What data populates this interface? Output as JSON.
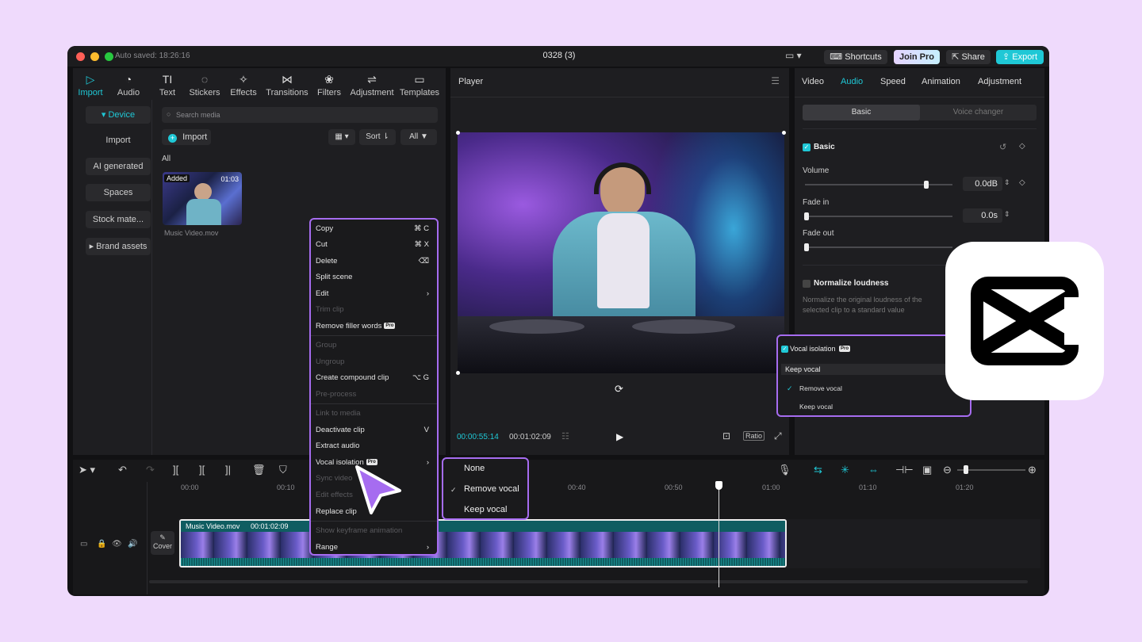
{
  "titlebar": {
    "autosave": "Auto saved: 18:26:16",
    "project": "0328 (3)",
    "shortcuts": "Shortcuts",
    "join_pro": "Join Pro",
    "share": "Share",
    "export": "Export"
  },
  "toolbar": [
    {
      "icon": "▷",
      "label": "Import"
    },
    {
      "icon": "◔",
      "label": "Audio"
    },
    {
      "icon": "TI",
      "label": "Text"
    },
    {
      "icon": "◌",
      "label": "Stickers"
    },
    {
      "icon": "✧",
      "label": "Effects"
    },
    {
      "icon": "⋈",
      "label": "Transitions"
    },
    {
      "icon": "❀",
      "label": "Filters"
    },
    {
      "icon": "⇌",
      "label": "Adjustment"
    },
    {
      "icon": "▭",
      "label": "Templates"
    }
  ],
  "sidebar": {
    "device": "▾ Device",
    "import": "Import",
    "ai": "AI generated",
    "spaces": "Spaces",
    "stock": "Stock mate...",
    "brand": "▸ Brand assets"
  },
  "media": {
    "search_placeholder": "Search media",
    "import_btn": "Import",
    "sort": "Sort",
    "all_btn": "All",
    "section": "All",
    "thumb_badge": "Added",
    "thumb_duration": "01:03",
    "thumb_name": "Music Video.mov"
  },
  "context_menu": {
    "copy": "Copy",
    "copy_sc": "⌘ C",
    "cut": "Cut",
    "cut_sc": "⌘ X",
    "delete": "Delete",
    "delete_sc": "⌫",
    "split": "Split scene",
    "edit": "Edit",
    "trim": "Trim clip",
    "filler": "Remove filler words",
    "pro_tag": "Pro",
    "group": "Group",
    "ungroup": "Ungroup",
    "compound": "Create compound clip",
    "compound_sc": "⌥ G",
    "preprocess": "Pre-process",
    "link": "Link to media",
    "deactivate": "Deactivate clip",
    "deactivate_sc": "V",
    "extract": "Extract audio",
    "vocal": "Vocal isolation",
    "sync": "Sync video",
    "edit_effects": "Edit effects",
    "replace": "Replace clip",
    "keyframe": "Show keyframe animation",
    "range": "Range"
  },
  "submenu": {
    "none": "None",
    "remove": "Remove vocal",
    "keep": "Keep vocal",
    "check": "✓"
  },
  "player": {
    "title": "Player",
    "current": "00:00:55:14",
    "total": "00:01:02:09",
    "ratio": "Ratio"
  },
  "inspector": {
    "tabs": [
      "Video",
      "Audio",
      "Speed",
      "Animation",
      "Adjustment"
    ],
    "seg_basic": "Basic",
    "seg_voice": "Voice changer",
    "section_basic": "Basic",
    "volume_label": "Volume",
    "volume_value": "0.0dB",
    "fadein_label": "Fade in",
    "fadein_value": "0.0s",
    "fadeout_label": "Fade out",
    "normalize_label": "Normalize loudness",
    "normalize_desc": "Normalize the original loudness of the selected clip to a standard value",
    "volume_level": 0.82
  },
  "vocal_popup": {
    "title": "Vocal isolation",
    "pro_tag": "Pro",
    "selected": "Keep vocal",
    "opt1": "Remove vocal",
    "opt2": "Keep vocal",
    "check": "✓"
  },
  "timeline": {
    "clip_name": "Music Video.mov",
    "clip_duration": "00:01:02:09",
    "cover": "Cover",
    "ticks": [
      "00:00",
      "00:10",
      "00:40",
      "00:50",
      "01:00",
      "01:10",
      "01:20"
    ]
  },
  "colors": {
    "accent": "#1fc8d6",
    "highlight": "#a66cf0",
    "background": "#efdafc"
  }
}
